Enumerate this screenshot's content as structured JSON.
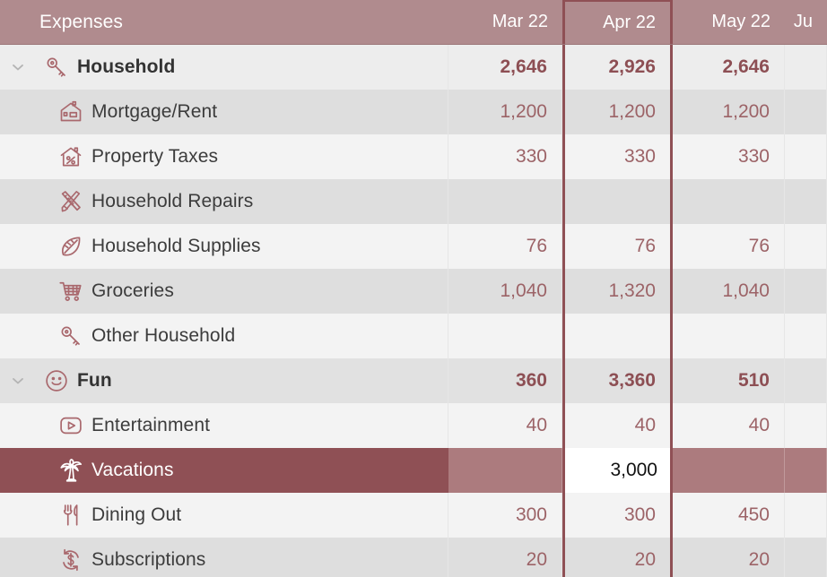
{
  "header": {
    "name_label": "Expenses",
    "columns": [
      {
        "label": "Mar 22",
        "width": 127,
        "selected": false
      },
      {
        "label": "Apr 22",
        "width": 123,
        "selected": true
      },
      {
        "label": "May 22",
        "width": 125,
        "selected": false
      },
      {
        "label": "Ju",
        "width": 47,
        "selected": false
      }
    ]
  },
  "colors": {
    "header_bg": "#b08b8e",
    "selection": "#8f5055",
    "selection_light": "#ac7b7e",
    "value_text": "#9c6367",
    "group_value_text": "#8d4f54",
    "label_text": "#3c3c3c",
    "row_light": "#f3f3f3",
    "row_dark": "#dedede",
    "group_row": "#ededed"
  },
  "rows": [
    {
      "label": "Household",
      "icon": "key-icon",
      "type": "group",
      "expanded": true,
      "selected": false,
      "values": [
        "2,646",
        "2,926",
        "2,646",
        ""
      ]
    },
    {
      "label": "Mortgage/Rent",
      "icon": "house-icon",
      "type": "child",
      "selected": false,
      "values": [
        "1,200",
        "1,200",
        "1,200",
        ""
      ]
    },
    {
      "label": "Property Taxes",
      "icon": "house-percent-icon",
      "type": "child",
      "selected": false,
      "values": [
        "330",
        "330",
        "330",
        ""
      ]
    },
    {
      "label": "Household Repairs",
      "icon": "ruler-pencil-icon",
      "type": "child",
      "selected": false,
      "values": [
        "",
        "",
        "",
        ""
      ]
    },
    {
      "label": "Household Supplies",
      "icon": "leaf-icon",
      "type": "child",
      "selected": false,
      "values": [
        "76",
        "76",
        "76",
        ""
      ]
    },
    {
      "label": "Groceries",
      "icon": "shopping-cart-icon",
      "type": "child",
      "selected": false,
      "values": [
        "1,040",
        "1,320",
        "1,040",
        ""
      ]
    },
    {
      "label": "Other Household",
      "icon": "key-icon",
      "type": "child",
      "selected": false,
      "values": [
        "",
        "",
        "",
        ""
      ]
    },
    {
      "label": "Fun",
      "icon": "smiley-icon",
      "type": "group",
      "expanded": true,
      "selected": false,
      "values": [
        "360",
        "3,360",
        "510",
        ""
      ]
    },
    {
      "label": "Entertainment",
      "icon": "play-icon",
      "type": "child",
      "selected": false,
      "values": [
        "40",
        "40",
        "40",
        ""
      ]
    },
    {
      "label": "Vacations",
      "icon": "palm-tree-icon",
      "type": "child",
      "selected": true,
      "editing_column": 1,
      "values": [
        "",
        "3,000",
        "",
        ""
      ]
    },
    {
      "label": "Dining Out",
      "icon": "fork-knife-icon",
      "type": "child",
      "selected": false,
      "values": [
        "300",
        "300",
        "450",
        ""
      ]
    },
    {
      "label": "Subscriptions",
      "icon": "dollar-refresh-icon",
      "type": "child",
      "selected": false,
      "values": [
        "20",
        "20",
        "20",
        ""
      ]
    }
  ]
}
